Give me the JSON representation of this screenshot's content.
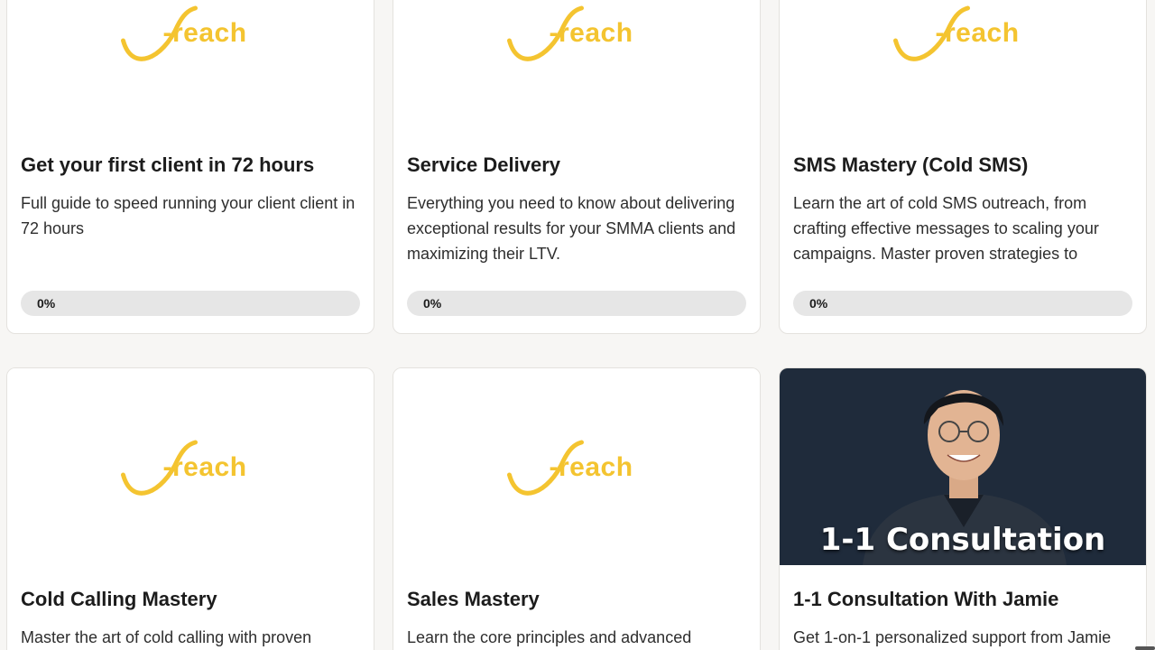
{
  "brand": {
    "logo_text": "-reach",
    "accent_color": "#f4c430"
  },
  "courses": [
    {
      "title": "Get your first client in 72 hours",
      "description": "Full guide to speed running your client client in 72 hours",
      "progress_label": "0%",
      "progress_percent": 0
    },
    {
      "title": "Service Delivery",
      "description": "Everything you need to know about delivering exceptional results for your SMMA clients and maximizing their LTV.",
      "progress_label": "0%",
      "progress_percent": 0
    },
    {
      "title": "SMS Mastery (Cold SMS)",
      "description": "Learn the art of cold SMS outreach, from crafting effective messages to scaling your campaigns. Master proven strategies to",
      "progress_label": "0%",
      "progress_percent": 0
    },
    {
      "title": "Cold Calling Mastery",
      "description": "Master the art of cold calling with proven"
    },
    {
      "title": "Sales Mastery",
      "description": "Learn the core principles and advanced"
    },
    {
      "title": "1-1 Consultation With Jamie",
      "description": "Get 1-on-1 personalized support from Jamie",
      "thumbnail_caption": "1-1 Consultation"
    }
  ]
}
